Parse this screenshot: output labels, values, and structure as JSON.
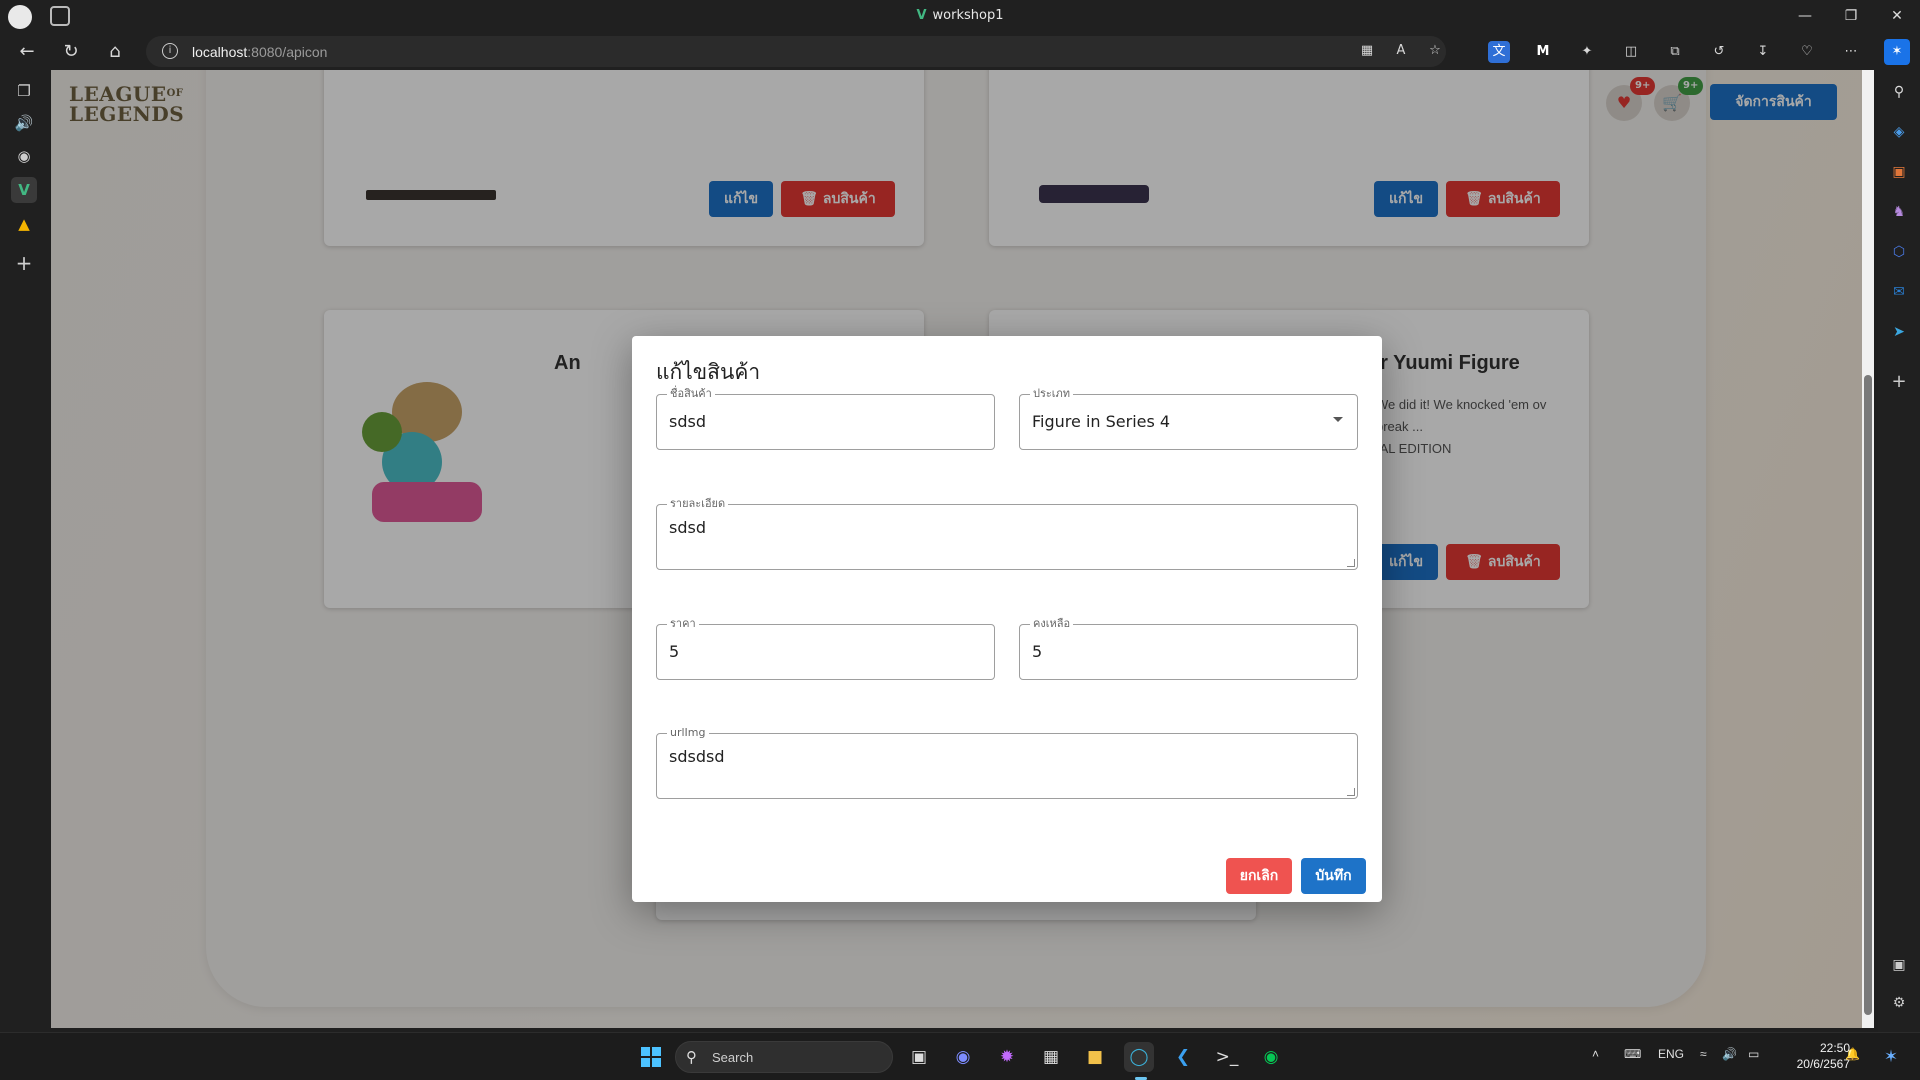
{
  "window": {
    "title": "workshop1",
    "title_v": "V"
  },
  "browser": {
    "url_host": "localhost",
    "url_rest": ":8080/apicon"
  },
  "header": {
    "logo_line1": "LEAGUE",
    "logo_of": "OF",
    "logo_line2": "LEGENDS",
    "wishlist_badge": "9+",
    "cart_badge": "9+",
    "manage_label": "จัดการสินค้า"
  },
  "cards": {
    "edit_label": "แก้ไข",
    "delete_label": "ลบสินค้า",
    "left_title_fragment": "An",
    "right_title_fragment": "er Yuumi Figure",
    "right_desc_1": "We did it! We knocked 'em ov",
    "right_desc_2": "break ...",
    "right_desc_3": "IAL EDITION"
  },
  "modal": {
    "title": "แก้ไขสินค้า",
    "name_label": "ชื่อสินค้า",
    "name_value": "sdsd",
    "type_label": "ประเภท",
    "type_value": "Figure in Series 4",
    "detail_label": "รายละเอียด",
    "detail_value": "sdsd",
    "price_label": "ราคา",
    "price_value": "5",
    "stock_label": "คงเหลือ",
    "stock_value": "5",
    "url_label": "urlImg",
    "url_value": "sdsdsd",
    "cancel_label": "ยกเลิก",
    "save_label": "บันทึก"
  },
  "taskbar": {
    "search_label": "Search",
    "lang": "ENG",
    "time": "22:50",
    "date": "20/6/2567"
  },
  "colors": {
    "primary": "#1e73c8",
    "danger": "#e53935",
    "badge_red": "#e53935",
    "badge_green": "#43a047"
  }
}
